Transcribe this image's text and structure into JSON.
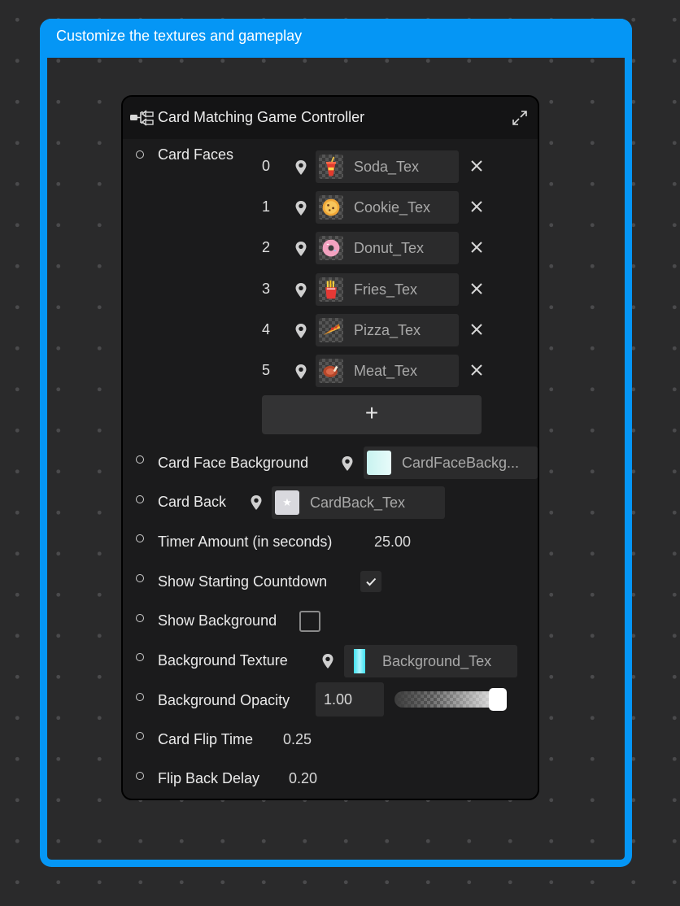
{
  "frame": {
    "title": "Customize the textures and gameplay"
  },
  "panel": {
    "title": "Card Matching Game Controller"
  },
  "card_faces": {
    "label": "Card Faces",
    "items": [
      {
        "index": "0",
        "name": "Soda_Tex",
        "icon": "soda-icon"
      },
      {
        "index": "1",
        "name": "Cookie_Tex",
        "icon": "cookie-icon"
      },
      {
        "index": "2",
        "name": "Donut_Tex",
        "icon": "donut-icon"
      },
      {
        "index": "3",
        "name": "Fries_Tex",
        "icon": "fries-icon"
      },
      {
        "index": "4",
        "name": "Pizza_Tex",
        "icon": "pizza-icon"
      },
      {
        "index": "5",
        "name": "Meat_Tex",
        "icon": "meat-icon"
      }
    ],
    "add_label": "+"
  },
  "card_face_background": {
    "label": "Card Face Background",
    "value": "CardFaceBackg..."
  },
  "card_back": {
    "label": "Card Back",
    "value": "CardBack_Tex"
  },
  "timer_amount": {
    "label": "Timer Amount (in seconds)",
    "value": "25.00"
  },
  "show_starting_countdown": {
    "label": "Show Starting Countdown",
    "checked": true
  },
  "show_background": {
    "label": "Show Background",
    "checked": false
  },
  "background_texture": {
    "label": "Background Texture",
    "value": "Background_Tex"
  },
  "background_opacity": {
    "label": "Background Opacity",
    "value": "1.00",
    "level": 1.0
  },
  "card_flip_time": {
    "label": "Card Flip Time",
    "value": "0.25"
  },
  "flip_back_delay": {
    "label": "Flip Back Delay",
    "value": "0.20"
  },
  "colors": {
    "accent": "#0596f5",
    "panel": "#1b1b1c",
    "field": "#2b2b2c"
  }
}
